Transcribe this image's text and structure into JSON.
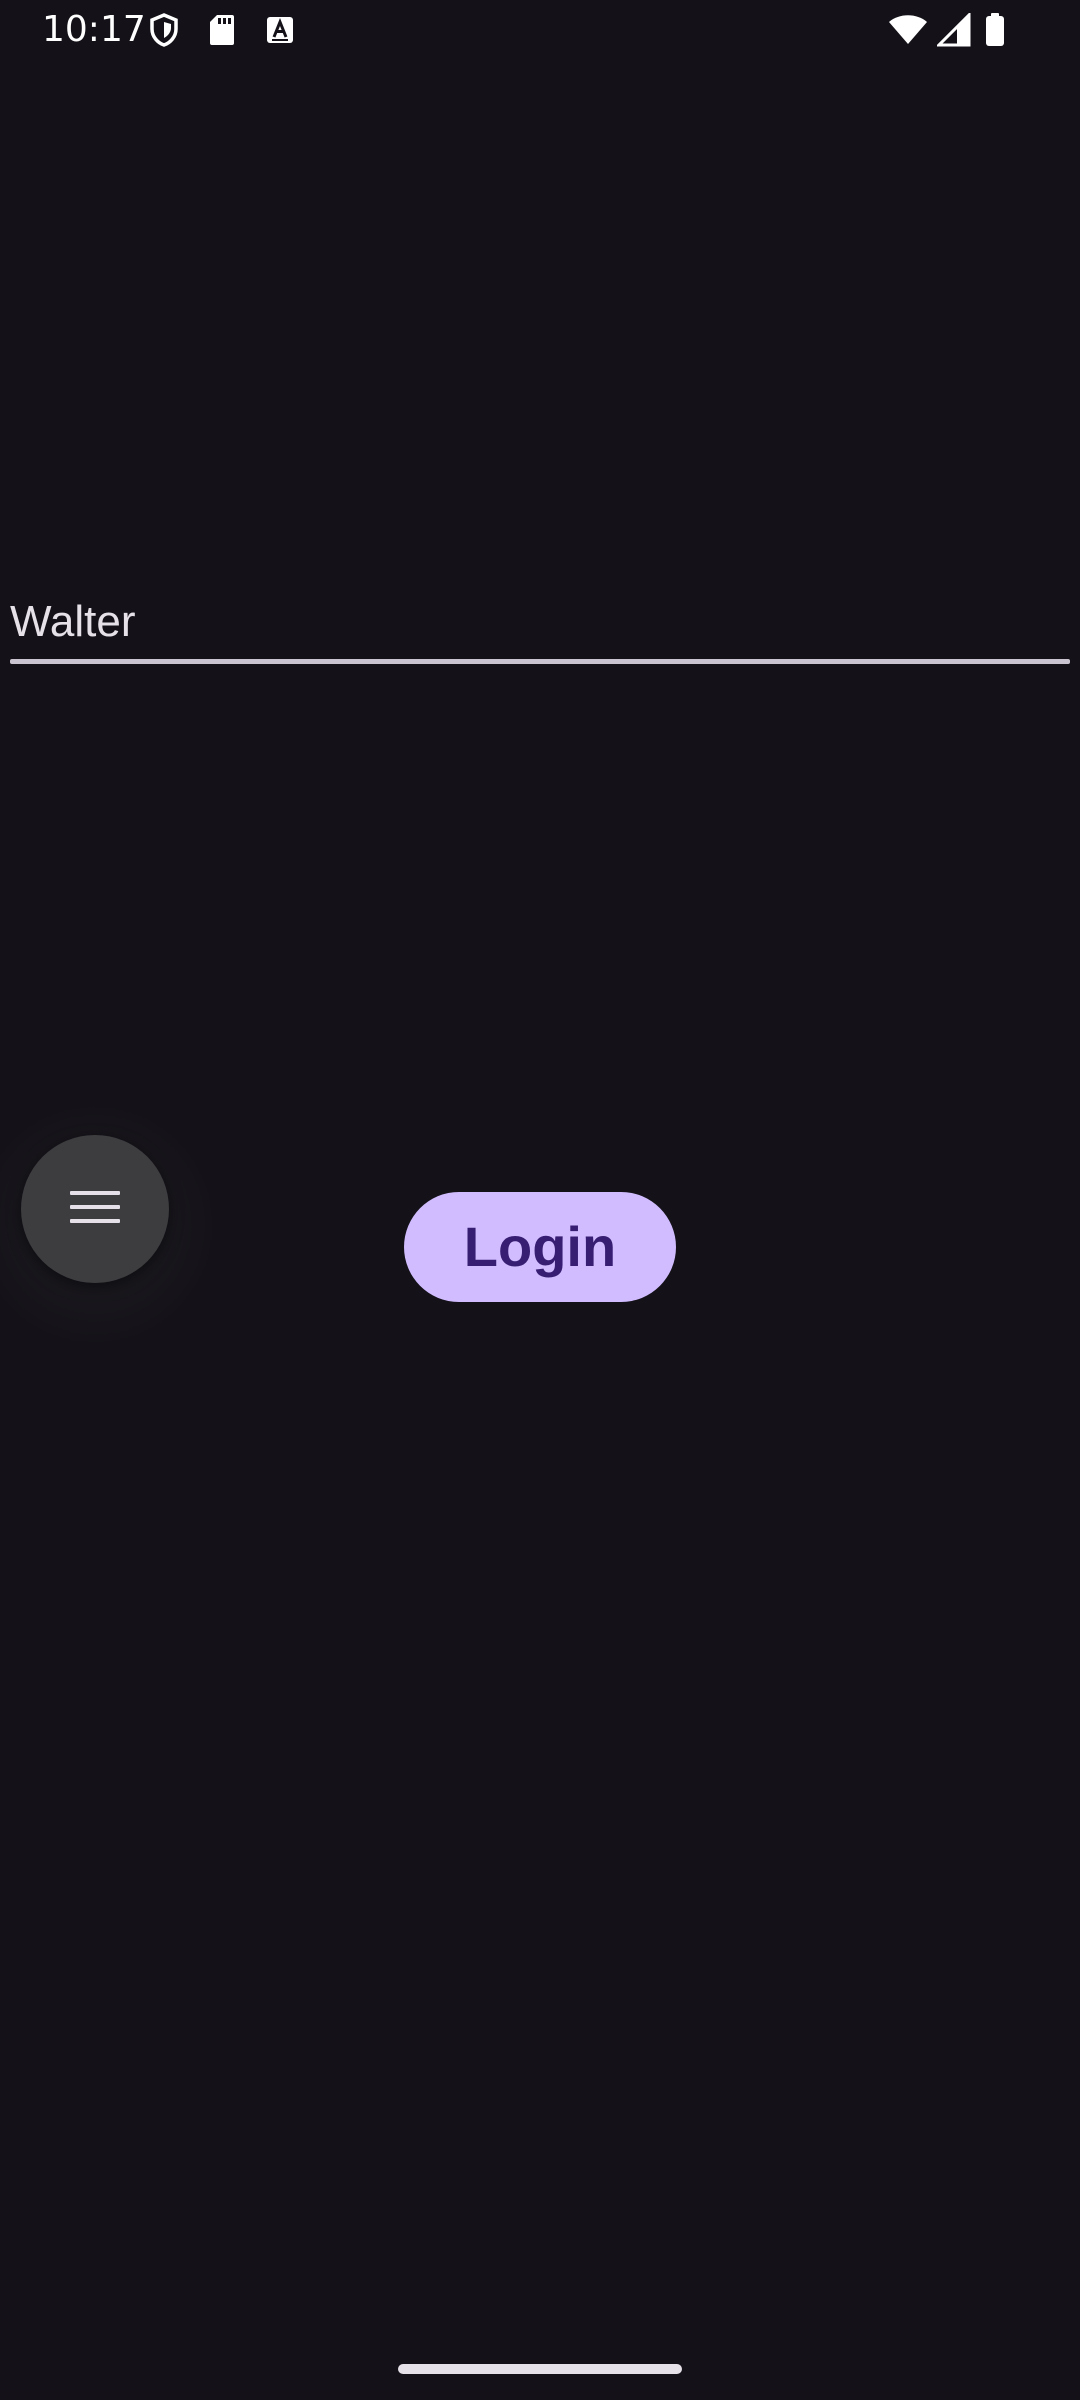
{
  "status_bar": {
    "time": "10:17",
    "left_icons": [
      "shield-icon",
      "sd-card-icon",
      "keyboard-a-icon"
    ],
    "right_icons": [
      "wifi-icon",
      "cell-signal-icon",
      "battery-icon"
    ]
  },
  "form": {
    "username_value": "Walter"
  },
  "floating_menu": {
    "icon": "menu-icon"
  },
  "login_button": {
    "label": "Login"
  },
  "colors": {
    "background": "#141218",
    "button_bg": "#D0BCFF",
    "button_text": "#381E72",
    "underline": "#CAC4D0",
    "fab_bg": "#3D3D40"
  }
}
